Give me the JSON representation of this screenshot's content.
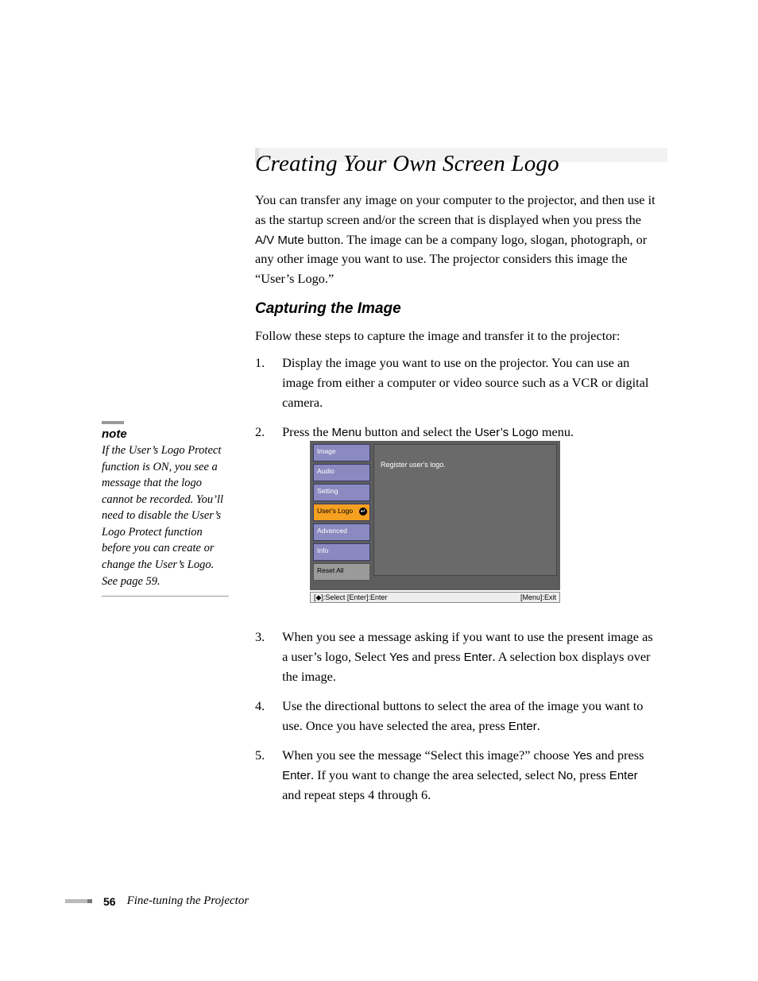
{
  "heading": "Creating Your Own Screen Logo",
  "intro_parts": {
    "a": "You can transfer any image on your computer to the projector, and then use it as the startup screen and/or the screen that is displayed when you press the ",
    "b": "A/V Mute",
    "c": " button. The image can be a company logo, slogan, photograph, or any other image you want to use. The projector considers this image the “User’s Logo.”"
  },
  "sub_heading": "Capturing the Image",
  "intro2": "Follow these steps to capture the image and transfer it to the projector:",
  "steps": {
    "s1": {
      "num": "1.",
      "text": "Display the image you want to use on the projector. You can use an image from either a computer or video source such as a VCR or digital camera."
    },
    "s2": {
      "num": "2.",
      "a": "Press the ",
      "b": "Menu",
      "c": " button and select the ",
      "d": "User’s Logo",
      "e": " menu."
    },
    "s3": {
      "num": "3.",
      "a": "When you see a message asking if you want to use the present image as a user’s logo, Select ",
      "b": "Yes",
      "c": " and press ",
      "d": "Enter",
      "e": ". A selection box displays over the image."
    },
    "s4": {
      "num": "4.",
      "a": "Use the directional buttons to select the area of the image you want to use. Once you have selected the area, press ",
      "b": "Enter",
      "c": "."
    },
    "s5": {
      "num": "5.",
      "a": "When you see the message “Select this image?” choose ",
      "b": "Yes",
      "c": " and press ",
      "d": "Enter",
      "e": ". If you want to change the area selected, select ",
      "f": "No",
      "g": ", press ",
      "h": "Enter",
      "i": " and repeat steps 4 through 6."
    }
  },
  "note": {
    "title": "note",
    "text": "If the User’s Logo Protect function is ON, you see a message that the logo cannot be recorded. You’ll need to disable the User’s Logo Protect function before you can create or change the User’s Logo. See page 59."
  },
  "menu": {
    "items": [
      "Image",
      "Audio",
      "Setting",
      "User's Logo",
      "Advanced",
      "Info",
      "Reset All"
    ],
    "content": "Register user's logo.",
    "footer_left": "[◆]:Select [Enter]:Enter",
    "footer_right": "[Menu]:Exit"
  },
  "footer": {
    "page": "56",
    "section": "Fine-tuning the Projector"
  }
}
